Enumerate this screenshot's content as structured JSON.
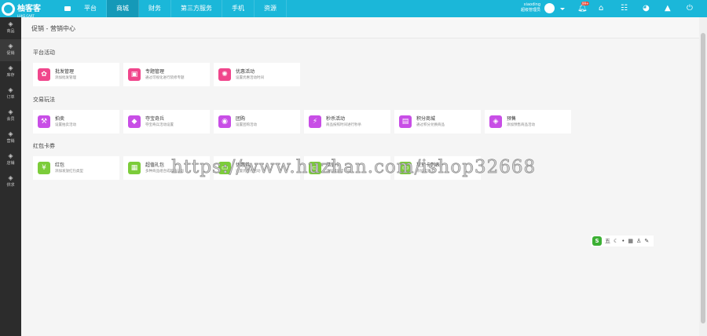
{
  "brand": {
    "name": "柚客客",
    "sub": "LUKE.CART"
  },
  "nav": [
    "平台",
    "商城",
    "财务",
    "第三方服务",
    "手机",
    "资源"
  ],
  "nav_active": 1,
  "user": {
    "name": "xiaoding",
    "role": "超级管理员"
  },
  "notification_badge": "99+",
  "sidebar": [
    {
      "label": "商品",
      "icon": "bag-icon"
    },
    {
      "label": "促销",
      "icon": "promo-icon"
    },
    {
      "label": "库存",
      "icon": "tag-icon"
    },
    {
      "label": "订单",
      "icon": "order-icon"
    },
    {
      "label": "会员",
      "icon": "member-icon"
    },
    {
      "label": "营销",
      "icon": "star-icon"
    },
    {
      "label": "店铺",
      "icon": "store-icon"
    },
    {
      "label": "供求",
      "icon": "supply-icon"
    }
  ],
  "breadcrumb": "促销 - 营销中心",
  "sections": [
    {
      "title": "平台活动",
      "color": "#f0468c",
      "cards": [
        {
          "title": "批发管理",
          "desc": "添加批发管理",
          "glyph": "✿"
        },
        {
          "title": "专题管理",
          "desc": "通过可视化进行装修专题",
          "glyph": "▣"
        },
        {
          "title": "优惠活动",
          "desc": "设置优惠活动时间",
          "glyph": "✺"
        }
      ]
    },
    {
      "title": "交易玩法",
      "color": "#c84ee6",
      "cards": [
        {
          "title": "拍卖",
          "desc": "设置拍卖活动",
          "glyph": "⚒"
        },
        {
          "title": "夺宝奇兵",
          "desc": "夺宝奇兵活动设置",
          "glyph": "◆"
        },
        {
          "title": "团购",
          "desc": "设置团购活动",
          "glyph": "◉"
        },
        {
          "title": "秒杀活动",
          "desc": "商品按照时间进行秒杀",
          "glyph": "⚡"
        },
        {
          "title": "积分商城",
          "desc": "通过积分兑换商品",
          "glyph": "▤"
        },
        {
          "title": "预售",
          "desc": "添加预售商品活动",
          "glyph": "◈"
        }
      ]
    },
    {
      "title": "红包卡券",
      "color": "#7ccc3a",
      "cards": [
        {
          "title": "红包",
          "desc": "添加发放红包类型",
          "glyph": "¥"
        },
        {
          "title": "超值礼包",
          "desc": "多种商品组合成超值礼包",
          "glyph": "▦"
        },
        {
          "title": "优惠券",
          "desc": "设置优惠券活动",
          "glyph": "▭"
        },
        {
          "title": "储值卡",
          "desc": "添加储值卡活动",
          "glyph": "▭"
        },
        {
          "title": "提货卡列表",
          "desc": "添加提货卡",
          "glyph": "▭"
        }
      ]
    }
  ],
  "watermark": "https://www.huzhan.com/ishop32668",
  "ime": {
    "label": "五"
  }
}
